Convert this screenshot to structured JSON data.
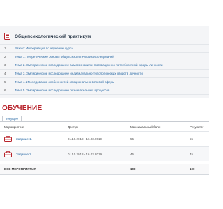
{
  "course": {
    "title": "Общепсихологический практикум",
    "topics": [
      {
        "num": "1",
        "label": "Важно: Информация по изучению курса"
      },
      {
        "num": "2",
        "label": "Тема 1. Теоретические основы общепсихологических исследований"
      },
      {
        "num": "3",
        "label": "Тема 2. Эмпирическое исследование самосознания и мотивационно-потребностной сферы личности"
      },
      {
        "num": "4",
        "label": "Тема 3. Эмпирическое исследование индивидуально-типологических свойств личности"
      },
      {
        "num": "5",
        "label": "Тема 4. Исследование особенностей эмоционально-волевой сферы"
      },
      {
        "num": "6",
        "label": "Тема 5. Эмпирическое исследование познавательных процессов"
      }
    ]
  },
  "training": {
    "title": "ОБУЧЕНИЕ",
    "tab": "Текущее",
    "columns": {
      "activity": "Мероприятие",
      "access": "Доступ",
      "max_score": "Максимальный балл",
      "result": "Результат"
    },
    "rows": [
      {
        "label": "Задание 1.",
        "access": "01.10.2018 - 16.03.2019",
        "max_score": "55",
        "result": "55"
      },
      {
        "label": "Задание 2.",
        "access": "01.10.2018 - 16.03.2019",
        "max_score": "45",
        "result": "45"
      }
    ],
    "total": {
      "label": "ВСЕ МЕРОПРИЯТИЯ",
      "max_score": "100",
      "result": "100"
    }
  },
  "colors": {
    "accent_red": "#b8232b",
    "link_blue": "#2a6aa5"
  },
  "icons": {
    "course": "book-icon",
    "task": "briefcase-icon"
  }
}
